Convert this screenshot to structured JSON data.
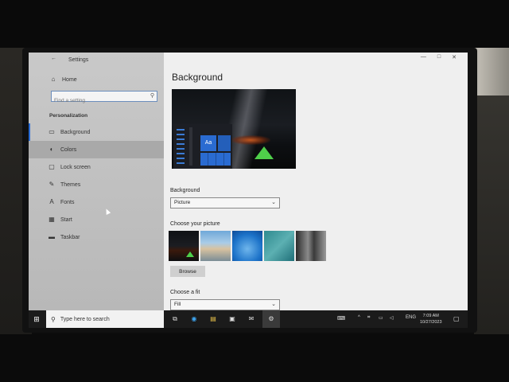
{
  "window": {
    "title": "Settings",
    "minimize_icon": "—",
    "maximize_icon": "□",
    "close_icon": "✕"
  },
  "sidebar": {
    "home_label": "Home",
    "search_placeholder": "Find a setting",
    "section_label": "Personalization",
    "items": [
      {
        "label": "Background",
        "icon": "picture-icon",
        "active": true
      },
      {
        "label": "Colors",
        "icon": "palette-icon",
        "active": false
      },
      {
        "label": "Lock screen",
        "icon": "monitor-icon",
        "active": false
      },
      {
        "label": "Themes",
        "icon": "brush-icon",
        "active": false
      },
      {
        "label": "Fonts",
        "icon": "font-icon",
        "active": false
      },
      {
        "label": "Start",
        "icon": "start-icon",
        "active": false
      },
      {
        "label": "Taskbar",
        "icon": "taskbar-icon",
        "active": false
      }
    ]
  },
  "main": {
    "title": "Background",
    "background_label": "Background",
    "background_value": "Picture",
    "choose_picture_label": "Choose your picture",
    "browse_label": "Browse",
    "choose_fit_label": "Choose a fit",
    "fit_value": "Fill",
    "tile_label": "Aa"
  },
  "taskbar": {
    "search_placeholder": "Type here to search",
    "tray_lang": "ENG",
    "time": "7:09 AM",
    "date": "10/27/2023",
    "tray_symbols": "^"
  },
  "colors": {
    "accent": "#2b6dd6",
    "taskbar": "#1b1b1b",
    "sidebar": "#c4c4c4"
  }
}
